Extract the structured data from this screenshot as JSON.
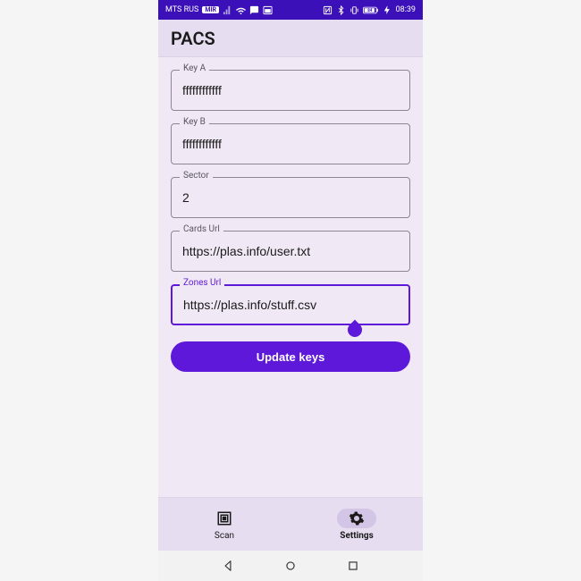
{
  "statusbar": {
    "carrier": "MTS RUS",
    "carrier_badge": "MIR",
    "time": "08:39",
    "battery": "84"
  },
  "appbar": {
    "title": "PACS"
  },
  "fields": [
    {
      "label": "Key A",
      "value": "ffffffffffff"
    },
    {
      "label": "Key B",
      "value": "ffffffffffff"
    },
    {
      "label": "Sector",
      "value": "2"
    },
    {
      "label": "Cards Url",
      "value": "https://plas.info/user.txt"
    },
    {
      "label": "Zones Url",
      "value": "https://plas.info/stuff.csv"
    }
  ],
  "focused_field_index": 4,
  "button": {
    "update": "Update keys"
  },
  "bottomnav": {
    "items": [
      {
        "label": "Scan"
      },
      {
        "label": "Settings"
      }
    ],
    "active_index": 1
  },
  "colors": {
    "accent": "#5e18d9",
    "statusbar": "#3b10b8",
    "surface": "#f0e9f5",
    "bar": "#e6ddf0"
  }
}
